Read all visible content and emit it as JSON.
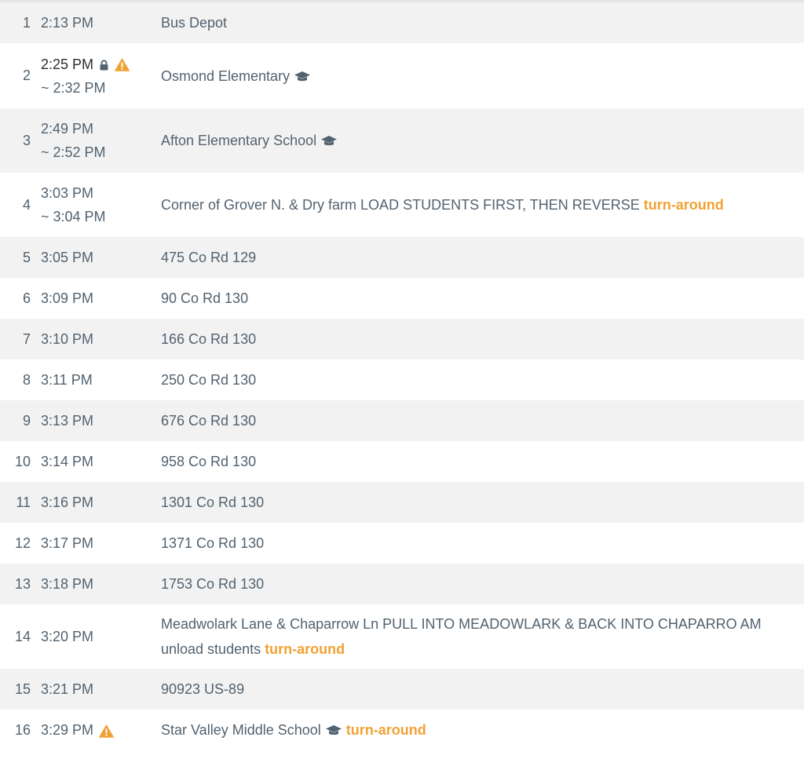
{
  "colors": {
    "accent": "#f1a133",
    "text": "#52626f",
    "text_strong": "#2a2e33",
    "row_alt": "#f2f2f2"
  },
  "icons": {
    "lock": "lock-icon",
    "warning": "warning-icon",
    "school": "graduation-cap-icon"
  },
  "stops": [
    {
      "num": "1",
      "time": "2:13 PM",
      "time_est": "",
      "name": "Bus Depot",
      "tag": ""
    },
    {
      "num": "2",
      "time": "2:25 PM",
      "time_est": "~ 2:32 PM",
      "name": "Osmond Elementary",
      "tag": ""
    },
    {
      "num": "3",
      "time": "2:49 PM",
      "time_est": "~ 2:52 PM",
      "name": "Afton Elementary School",
      "tag": ""
    },
    {
      "num": "4",
      "time": "3:03 PM",
      "time_est": "~ 3:04 PM",
      "name": "Corner of Grover N. & Dry farm LOAD STUDENTS FIRST, THEN REVERSE",
      "tag": "turn-around"
    },
    {
      "num": "5",
      "time": "3:05 PM",
      "time_est": "",
      "name": "475 Co Rd 129",
      "tag": ""
    },
    {
      "num": "6",
      "time": "3:09 PM",
      "time_est": "",
      "name": "90 Co Rd 130",
      "tag": ""
    },
    {
      "num": "7",
      "time": "3:10 PM",
      "time_est": "",
      "name": "166 Co Rd 130",
      "tag": ""
    },
    {
      "num": "8",
      "time": "3:11 PM",
      "time_est": "",
      "name": "250 Co Rd 130",
      "tag": ""
    },
    {
      "num": "9",
      "time": "3:13 PM",
      "time_est": "",
      "name": "676 Co Rd 130",
      "tag": ""
    },
    {
      "num": "10",
      "time": "3:14 PM",
      "time_est": "",
      "name": "958 Co Rd 130",
      "tag": ""
    },
    {
      "num": "11",
      "time": "3:16 PM",
      "time_est": "",
      "name": "1301 Co Rd 130",
      "tag": ""
    },
    {
      "num": "12",
      "time": "3:17 PM",
      "time_est": "",
      "name": "1371 Co Rd 130",
      "tag": ""
    },
    {
      "num": "13",
      "time": "3:18 PM",
      "time_est": "",
      "name": "1753 Co Rd 130",
      "tag": ""
    },
    {
      "num": "14",
      "time": "3:20 PM",
      "time_est": "",
      "name": "Meadwolark Lane & Chaparrow Ln PULL INTO MEADOWLARK & BACK INTO CHAPARRO AM unload students",
      "tag": "turn-around"
    },
    {
      "num": "15",
      "time": "3:21 PM",
      "time_est": "",
      "name": "90923 US-89",
      "tag": ""
    },
    {
      "num": "16",
      "time": "3:29 PM",
      "time_est": "",
      "name": "Star Valley Middle School",
      "tag": "turn-around"
    }
  ]
}
